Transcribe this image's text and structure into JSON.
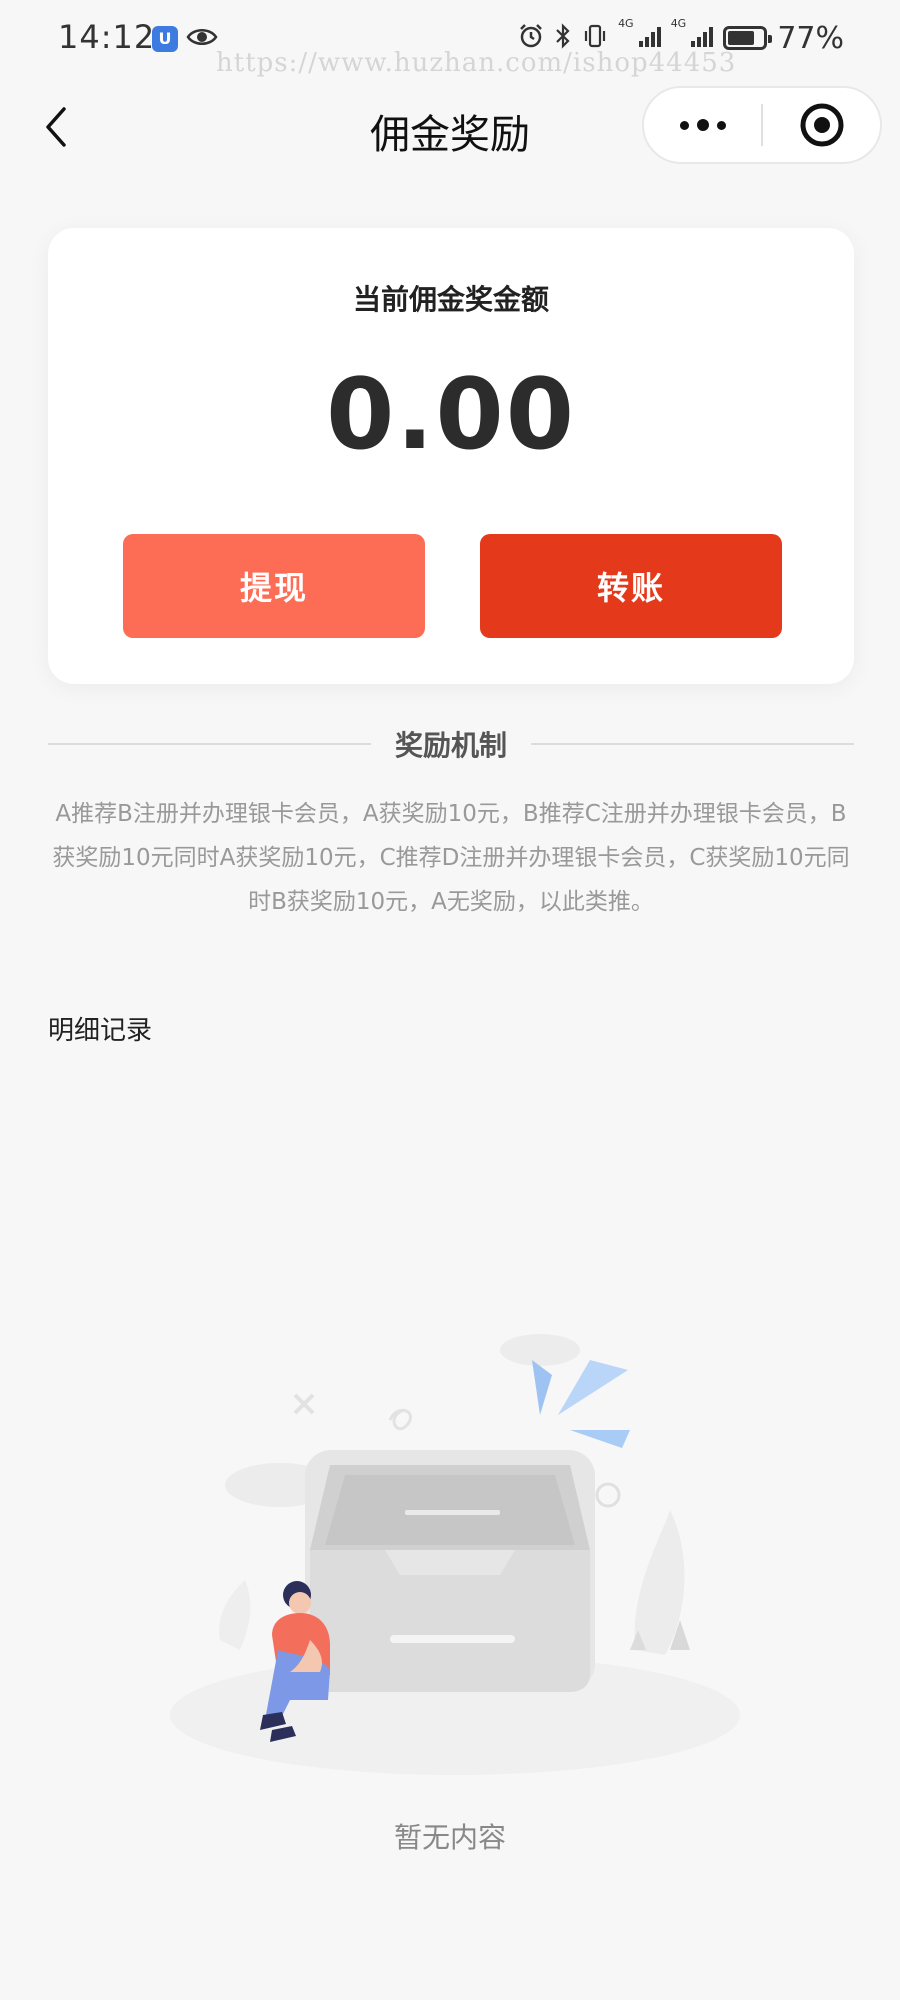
{
  "status_bar": {
    "time": "14:12",
    "badge": "U",
    "network_1": "4G",
    "network_2": "4G",
    "battery_percent": "77%",
    "battery_level": 0.77
  },
  "watermark": "https://www.huzhan.com/ishop44453",
  "nav": {
    "title": "佣金奖励"
  },
  "balance_card": {
    "title": "当前佣金奖金额",
    "amount": "0.00",
    "withdraw_label": "提现",
    "transfer_label": "转账"
  },
  "reward_rules": {
    "heading": "奖励机制",
    "text": "A推荐B注册并办理银卡会员，A获奖励10元，B推荐C注册并办理银卡会员，B获奖励10元同时A获奖励10元，C推荐D注册并办理银卡会员，C获奖励10元同时B获奖励10元，A无奖励，以此类推。"
  },
  "details": {
    "title": "明细记录",
    "empty_text": "暂无内容"
  },
  "colors": {
    "withdraw_button": "#fd6c55",
    "transfer_button": "#e4391b",
    "page_background": "#f7f7f7",
    "card_background": "#ffffff"
  }
}
